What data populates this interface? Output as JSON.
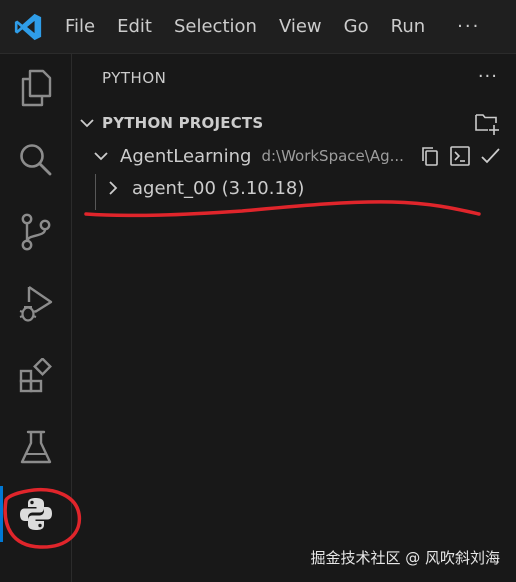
{
  "menu": {
    "items": [
      "File",
      "Edit",
      "Selection",
      "View",
      "Go",
      "Run"
    ],
    "more": "···"
  },
  "activity_bar": {
    "items": [
      "explorer-icon",
      "search-icon",
      "source-control-icon",
      "run-debug-icon",
      "extensions-icon",
      "testing-icon",
      "python-icon"
    ],
    "active": "python-icon",
    "accent_color": "#0078d4"
  },
  "panel": {
    "title": "PYTHON",
    "more": "···",
    "section": {
      "title": "PYTHON PROJECTS"
    },
    "project": {
      "name": "AgentLearning",
      "path": "d:\\WorkSpace\\Ag..."
    },
    "env": {
      "label": "agent_00 (3.10.18)"
    }
  },
  "annotation": {
    "color": "#e0252b"
  },
  "watermark": "掘金技术社区 @ 风吹斜刘海"
}
